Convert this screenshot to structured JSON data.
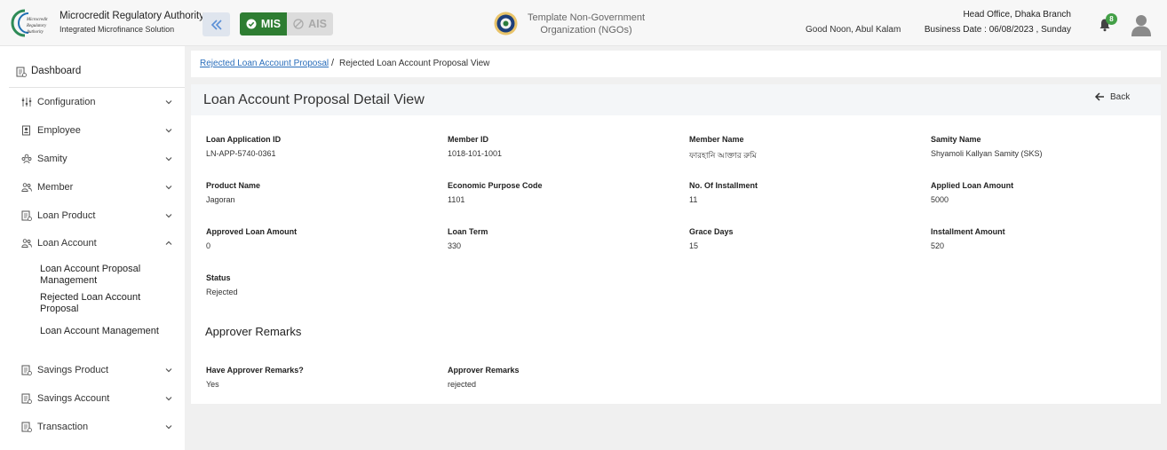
{
  "header": {
    "org_name": "Microcredit Regulatory Authority",
    "org_sub": "Integrated Microfinance Solution",
    "logo_text": "Microcredit Regulatory Authority",
    "mis_label": "MIS",
    "ais_label": "AIS",
    "ngo_name": "Template Non-Government Organization (NGOs)",
    "greeting": "Good Noon, Abul Kalam",
    "branch": "Head Office, Dhaka Branch",
    "business_date": "Business Date : 06/08/2023 , Sunday",
    "notification_count": "8",
    "accent": "#2e7d32"
  },
  "sidebar": {
    "dashboard": "Dashboard",
    "items": [
      {
        "label": "Configuration",
        "icon": "sliders-icon",
        "expanded": false
      },
      {
        "label": "Employee",
        "icon": "id-card-icon",
        "expanded": false
      },
      {
        "label": "Samity",
        "icon": "group-icon",
        "expanded": false
      },
      {
        "label": "Member",
        "icon": "people-icon",
        "expanded": false
      },
      {
        "label": "Loan Product",
        "icon": "document-icon",
        "expanded": false
      },
      {
        "label": "Loan Account",
        "icon": "people-icon",
        "expanded": true
      },
      {
        "label": "Savings Product",
        "icon": "document-icon",
        "expanded": false
      },
      {
        "label": "Savings Account",
        "icon": "document-icon",
        "expanded": false
      },
      {
        "label": "Transaction",
        "icon": "document-icon",
        "expanded": false
      }
    ],
    "loan_account_sub": [
      "Loan Account Proposal Management",
      "Rejected Loan Account Proposal",
      "Loan Account Management"
    ]
  },
  "breadcrumb": {
    "link": "Rejected Loan Account Proposal",
    "separator": "/",
    "current": "Rejected Loan Account Proposal View"
  },
  "page": {
    "title": "Loan Account Proposal Detail View",
    "back_label": "Back"
  },
  "details": [
    {
      "label": "Loan Application ID",
      "value": "LN-APP-5740-0361"
    },
    {
      "label": "Member ID",
      "value": "1018-101-1001"
    },
    {
      "label": "Member Name",
      "value": "ফারহানি আক্তার রুমি"
    },
    {
      "label": "Samity Name",
      "value": "Shyamoli Kallyan Samity (SKS)"
    },
    {
      "label": "Product Name",
      "value": "Jagoran"
    },
    {
      "label": "Economic Purpose Code",
      "value": "1101"
    },
    {
      "label": "No. Of Installment",
      "value": "11"
    },
    {
      "label": "Applied Loan Amount",
      "value": "5000"
    },
    {
      "label": "Approved Loan Amount",
      "value": "0"
    },
    {
      "label": "Loan Term",
      "value": "330"
    },
    {
      "label": "Grace Days",
      "value": "15"
    },
    {
      "label": "Installment Amount",
      "value": "520"
    },
    {
      "label": "Status",
      "value": "Rejected"
    }
  ],
  "remarks": {
    "section_title": "Approver Remarks",
    "fields": [
      {
        "label": "Have Approver Remarks?",
        "value": "Yes"
      },
      {
        "label": "Approver Remarks",
        "value": "rejected"
      }
    ]
  }
}
